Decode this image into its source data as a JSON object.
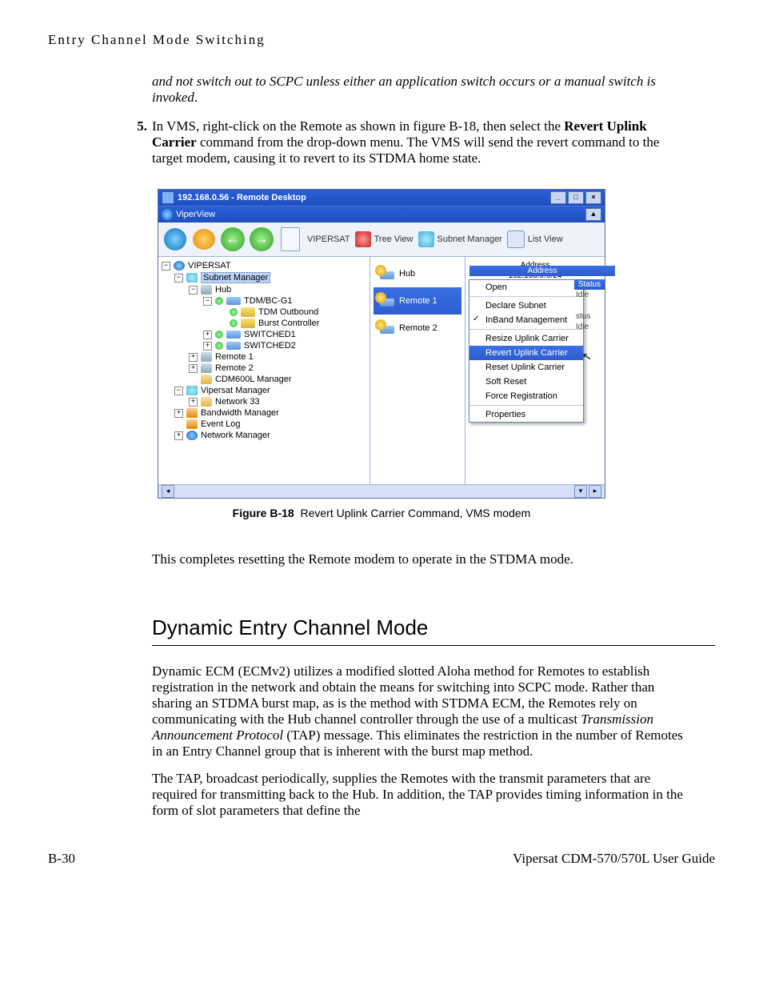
{
  "header": "Entry Channel Mode Switching",
  "intro_italic": "and not switch out to SCPC unless either an application switch occurs or a manual switch is invoked",
  "step_num": "5.",
  "step_text_a": "In VMS, right-click on the Remote as shown in figure B-18, then select the ",
  "step_bold": "Revert Uplink Carrier",
  "step_text_b": " command from the drop-down menu. The VMS will send the revert command to the target modem, causing it to revert to its STDMA home state.",
  "figure_label": "Figure B-18",
  "figure_caption": "Revert Uplink Carrier Command, VMS modem",
  "after_figure": "This completes resetting the Remote modem to operate in the STDMA mode.",
  "section_title": "Dynamic Entry Channel Mode",
  "para1_a": "Dynamic ECM (ECMv2) utilizes a modified slotted Aloha method for Remotes to establish registration in the network and obtain the means for switching into SCPC mode. Rather than sharing an STDMA burst map, as is the method with STDMA ECM, the Remotes rely on communicating with the Hub channel controller through the use of a multicast ",
  "para1_italic": "Transmission Announcement Protocol",
  "para1_b": " (TAP) message. This eliminates the restriction in the number of Remotes in an Entry Channel group that is inherent with the burst map method.",
  "para2": "The TAP, broadcast periodically, supplies the Remotes with the transmit parameters that are required for transmitting back to the Hub. In addition, the TAP provides timing information in the form of slot parameters that define the",
  "footer_left": "B-30",
  "footer_right": "Vipersat CDM-570/570L User Guide",
  "vms": {
    "title": "192.168.0.56 - Remote Desktop",
    "subtitle": "ViperView",
    "toolbar": {
      "vipersat": "VIPERSAT",
      "treeview": "Tree View",
      "subnetmgr": "Subnet Manager",
      "listview": "List View"
    },
    "tree": {
      "root": "VIPERSAT",
      "subnet_mgr": "Subnet Manager",
      "hub": "Hub",
      "tdm": "TDM/BC-G1",
      "tdm_out": "TDM Outbound",
      "burst": "Burst Controller",
      "sw1": "SWITCHED1",
      "sw2": "SWITCHED2",
      "remote1": "Remote 1",
      "remote2": "Remote 2",
      "cdm": "CDM600L Manager",
      "vip_mgr": "Vipersat Manager",
      "net33": "Network 33",
      "bw_mgr": "Bandwidth Manager",
      "event_log": "Event Log",
      "net_mgr": "Network Manager"
    },
    "mid": {
      "hub": "Hub",
      "remote1": "Remote 1",
      "remote2": "Remote 2"
    },
    "right": {
      "address_hdr": "Address",
      "address_val": "192.168.0.0/24",
      "address_hdr2": "Address",
      "status_hdr": "Status",
      "status_idle": "Idle",
      "status_stus": "stus",
      "status_idle2": "Idle"
    },
    "menu": {
      "open": "Open",
      "declare": "Declare Subnet",
      "inband": "InBand Management",
      "resize": "Resize Uplink Carrier",
      "revert": "Revert Uplink Carrier",
      "reset": "Reset Uplink Carrier",
      "soft": "Soft Reset",
      "force": "Force Registration",
      "props": "Properties"
    }
  }
}
